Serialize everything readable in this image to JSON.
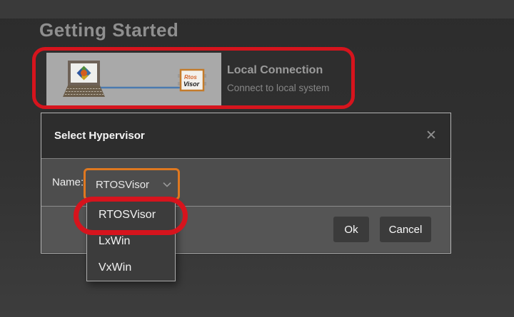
{
  "page": {
    "heading": "Getting Started"
  },
  "connection_card": {
    "title": "Local Connection",
    "subtitle": "Connect to local system",
    "chip_line1": "Rtos",
    "chip_line2": "Visor"
  },
  "dialog": {
    "title": "Select Hypervisor",
    "name_label": "Name:",
    "select": {
      "value": "RTOSVisor"
    },
    "options": [
      "RTOSVisor",
      "LxWin",
      "VxWin"
    ],
    "buttons": {
      "ok": "Ok",
      "cancel": "Cancel"
    }
  },
  "icons": {
    "close": "✕"
  },
  "colors": {
    "annotation_red": "#d6141d",
    "annotation_orange": "#df7820",
    "dialog_header_bg": "#2d2d2d",
    "dialog_body_bg": "#4d4d4d",
    "dialog_footer_bg": "#555555",
    "popup_bg": "#3c3c3c",
    "button_bg": "#3b3b3b",
    "connector_blue": "#4a7ab0"
  }
}
